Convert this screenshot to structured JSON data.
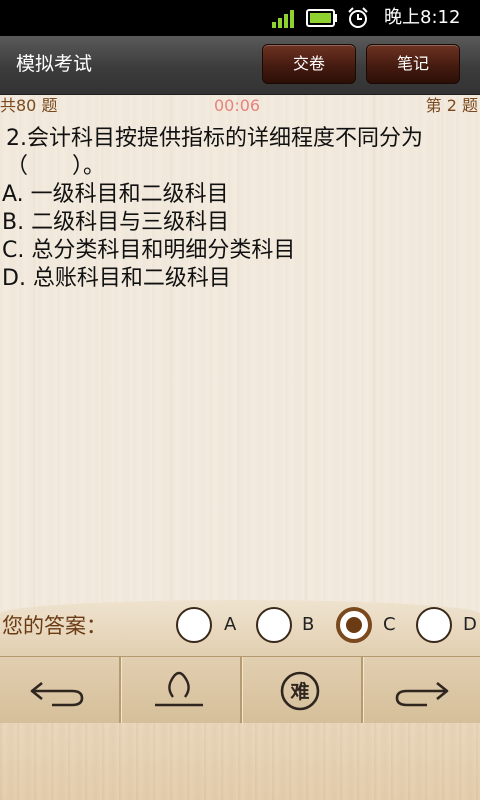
{
  "status_bar": {
    "time": "晚上8:12",
    "icons": [
      "signal-icon",
      "battery-icon",
      "alarm-clock-icon"
    ]
  },
  "header": {
    "title": "模拟考试",
    "submit_label": "交卷",
    "notes_label": "笔记"
  },
  "exam": {
    "total": "共80 题",
    "timer": "00:06",
    "current": "第 2 题"
  },
  "question": {
    "stem": "2.会计科目按提供指标的详细程度不同分为（　　）。",
    "options": [
      "A. 一级科目和二级科目",
      "B. 二级科目与三级科目",
      "C. 总分类科目和明细分类科目",
      "D. 总账科目和二级科目"
    ]
  },
  "answer": {
    "label": "您的答案：",
    "choices": [
      "A",
      "B",
      "C",
      "D"
    ],
    "selected": "C"
  },
  "toolbar": {
    "icons": [
      "back-arrow-icon",
      "stamp-icon",
      "difficulty-icon",
      "forward-arrow-icon"
    ],
    "difficulty_glyph": "难"
  },
  "colors": {
    "accent_brown": "#6b3b14",
    "timer_red": "#e6827c",
    "header_button": "#451b10"
  }
}
